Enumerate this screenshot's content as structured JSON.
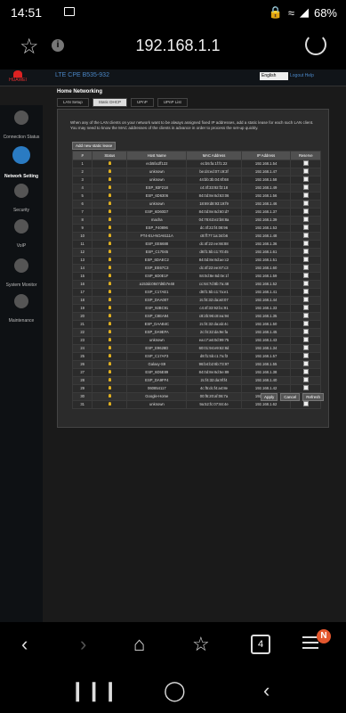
{
  "status": {
    "time": "14:51",
    "battery": "68%"
  },
  "browser": {
    "url": "192.168.1.1",
    "tab_count": "4",
    "menu_badge": "N"
  },
  "router": {
    "brand": "HUAWEI",
    "product": "LTE CPE B535-932",
    "language": "English",
    "links": "Logout  Help",
    "nav": [
      {
        "label": "Connection Status"
      },
      {
        "label": "Network Setting"
      },
      {
        "label": "Security"
      },
      {
        "label": "VoIP"
      },
      {
        "label": "System Monitor"
      },
      {
        "label": "Maintenance"
      }
    ],
    "section_title": "Home Networking",
    "tabs": [
      "LAN Setup",
      "Static DHCP",
      "UPnP",
      "UPnP List"
    ],
    "notice": "When any of the LAN clients on your network want to be always assigned fixed IP addresses, add a static lease for each such LAN client. You may need to know the MAC addresses of the clients in advance in order to process the set-up quickly.",
    "add_button": "Add new static lease",
    "columns": [
      "#",
      "Status",
      "Host Name",
      "MAC Address",
      "IP Address",
      "Reserve"
    ],
    "rows": [
      [
        "1",
        "ecb5fa1ff122",
        "ec:b5:fa:1f:f1:22",
        "192.168.1.54"
      ],
      [
        "2",
        "unknown",
        "be:d4:ed:07:c9:3f",
        "192.168.1.47"
      ],
      [
        "3",
        "unknown",
        "44:bb:3b:04:6f:68",
        "192.168.1.58"
      ],
      [
        "4",
        "ESP_93F218",
        "c4:4f:33:92:f2:18",
        "192.168.1.49"
      ],
      [
        "5",
        "ESP_6D6306",
        "84:0d:8e:6d:63:06",
        "192.168.1.56"
      ],
      [
        "6",
        "unknown",
        "18:69:d8:93:19:f9",
        "192.168.1.46"
      ],
      [
        "7",
        "ESP_6D60D7",
        "84:0d:8e:6d:60:d7",
        "192.168.1.37"
      ],
      [
        "8",
        "macha",
        "04:78:63:e2:b8:8a",
        "192.168.1.39"
      ],
      [
        "9",
        "ESP_F40896",
        "dc:4f:22:f4:08:96",
        "192.168.1.53"
      ],
      [
        "10",
        "PT4-EU-NOA6111A",
        "c8:ff:77:1a:34:b6",
        "192.168.1.48"
      ],
      [
        "11",
        "ESP_EE6688",
        "dc:4f:22:ee:66:88",
        "192.168.1.36"
      ],
      [
        "12",
        "ESP_C17045",
        "d8:f1:5b:c1:70:45",
        "192.168.1.61"
      ],
      [
        "13",
        "ESP_6DAEC2",
        "84:0d:8e:6d:ae:c2",
        "192.168.1.51"
      ],
      [
        "14",
        "ESP_EE67C3",
        "dc:4f:22:ee:67:c3",
        "192.168.1.60"
      ],
      [
        "15",
        "ESP_6D0E1F",
        "84:0d:8e:6d:0e:1f",
        "192.168.1.59"
      ],
      [
        "16",
        "a153dc0847d6b7e48",
        "cc:64:7d:8b:7a:48",
        "192.168.1.52"
      ],
      [
        "17",
        "ESP_C17AE1",
        "d8:f1:5b:c1:7a:e1",
        "192.168.1.41"
      ],
      [
        "18",
        "ESP_DAA007",
        "2c:f4:32:da:a0:07",
        "192.168.1.44"
      ],
      [
        "19",
        "ESP_92BC91",
        "c4:4f:33:92:bc:91",
        "192.168.1.33"
      ],
      [
        "20",
        "ESP_C8EA94",
        "c8:2b:96:c8:ea:94",
        "192.168.1.35"
      ],
      [
        "21",
        "ESP_DAAB4C",
        "2c:f4:32:da:ab:4c",
        "192.168.1.50"
      ],
      [
        "22",
        "ESP_DA9EFA",
        "2c:f4:32:da:9e:fa",
        "192.168.1.45"
      ],
      [
        "23",
        "unknown",
        "ea:c7:a6:0d:99:75",
        "192.168.1.43"
      ],
      [
        "24",
        "ESP_E9628D",
        "60:01:94:e9:62:8d",
        "192.168.1.34"
      ],
      [
        "25",
        "ESP_C17AF3",
        "d8:f1:5b:c1:7a:f3",
        "192.168.1.57"
      ],
      [
        "26",
        "Galaxy-S9",
        "96:b4:b2:6b:73:97",
        "192.168.1.55"
      ],
      [
        "27",
        "ESP_6D5E89",
        "84:0d:8e:6d:5e:89",
        "192.168.1.38"
      ],
      [
        "28",
        "ESP_DA9FF4",
        "2c:f4:32:da:9f:f4",
        "192.168.1.40"
      ],
      [
        "29",
        "060854117",
        "4c:f5:dc:f4:a4:8e",
        "192.168.1.42"
      ],
      [
        "30",
        "Google-Home",
        "00:f6:20:af:06:7a",
        "192.168.1.63"
      ],
      [
        "31",
        "unknown",
        "9a:52:fc:07:84:4e",
        "192.168.1.62"
      ]
    ],
    "buttons": [
      "Apply",
      "Cancel",
      "Refresh"
    ]
  }
}
